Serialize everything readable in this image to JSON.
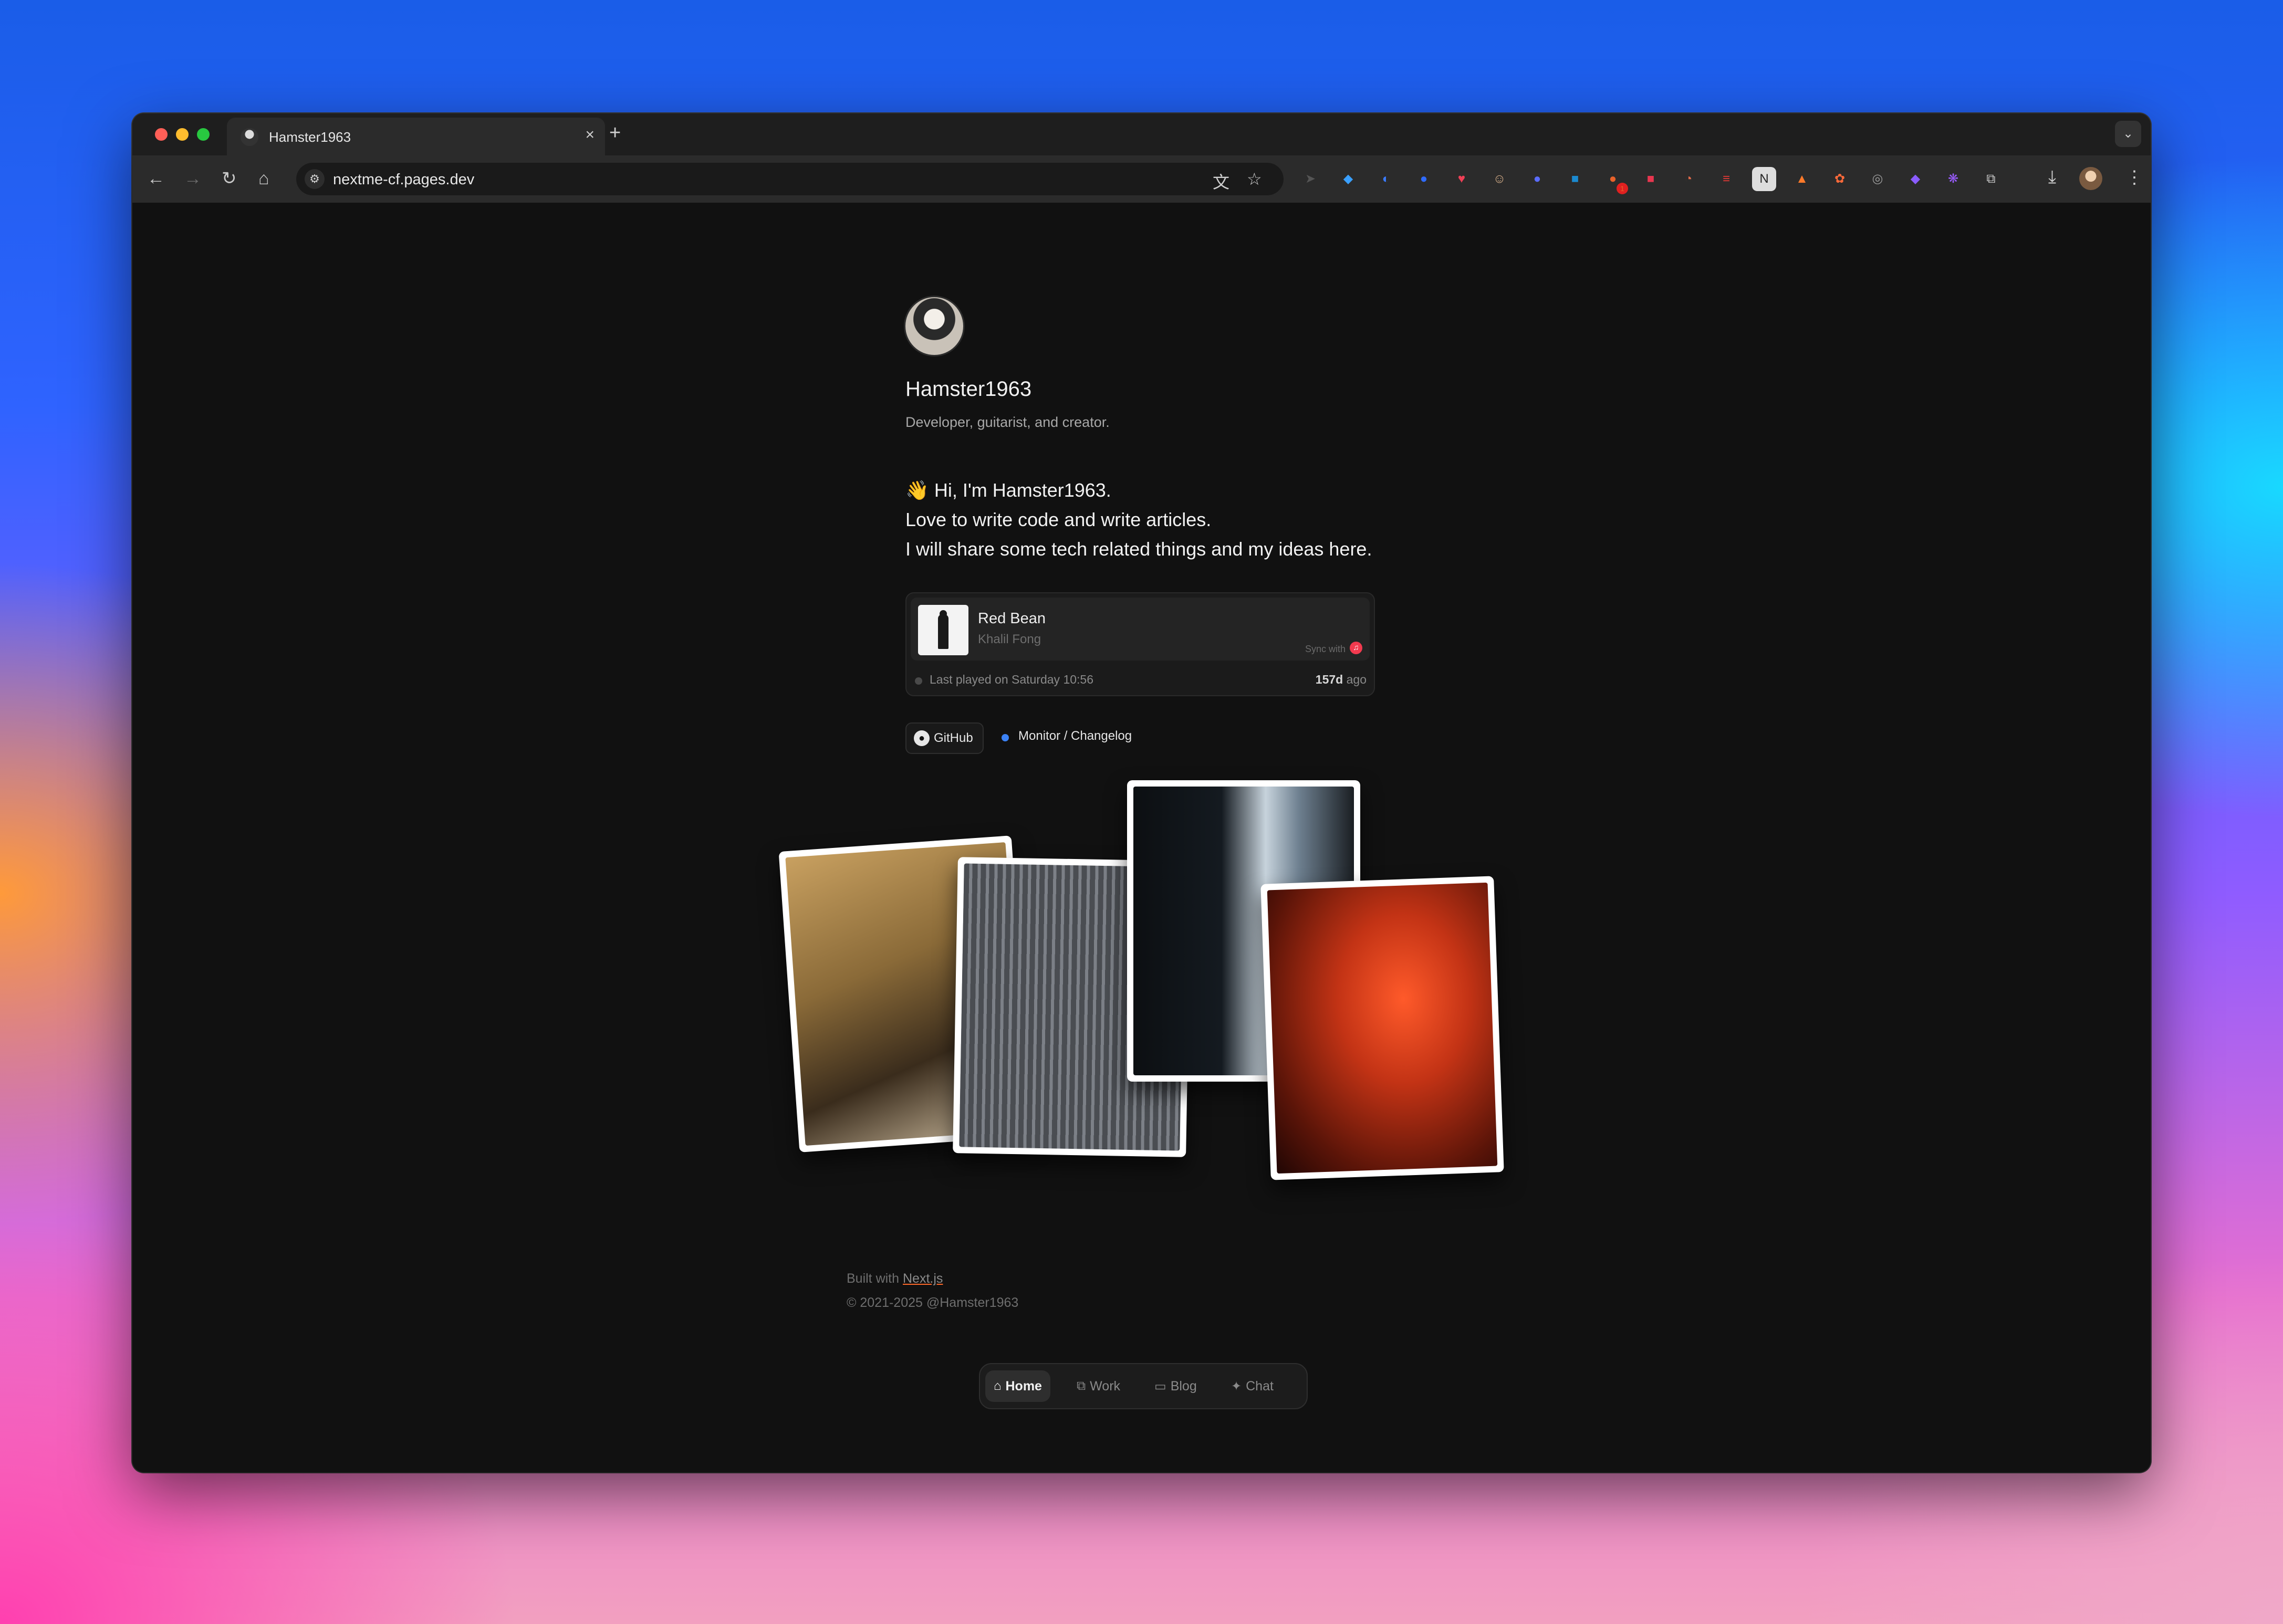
{
  "browser": {
    "tab_title": "Hamster1963",
    "new_tab": "+",
    "tab_close": "×",
    "url": "nextme-cf.pages.dev",
    "extensions_badge": "1"
  },
  "profile": {
    "name": "Hamster1963",
    "tagline": "Developer, guitarist, and creator."
  },
  "intro": {
    "line1": "👋 Hi, I'm Hamster1963.",
    "line2": "Love to write code and write articles.",
    "line3": "I will share some tech related things and my ideas here."
  },
  "music": {
    "song": "Red Bean",
    "artist": "Khalil Fong",
    "sync": "Sync with",
    "last_played": "Last played on Saturday 10:56",
    "ago_value": "157d",
    "ago_suffix": "ago"
  },
  "links": {
    "github": "GitHub",
    "monitor": "Monitor / Changelog"
  },
  "footer": {
    "built_prefix": "Built with",
    "built_link": "Next.js",
    "copyright": "© 2021-2025  @Hamster1963"
  },
  "nav": {
    "home": "Home",
    "work": "Work",
    "blog": "Blog",
    "chat": "Chat"
  },
  "colors": {
    "page_bg": "#111111",
    "status_dot": "#3b82f6",
    "music_icon": "#f23a4f"
  }
}
